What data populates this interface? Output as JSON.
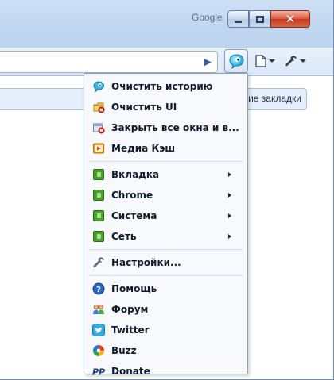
{
  "titlebar": {
    "brand": "Google",
    "buttons": [
      "minimize",
      "maximize",
      "close"
    ]
  },
  "toolbar": {
    "go_icon": "play-arrow-icon",
    "ext_icon": "extension-speech-bubble-icon",
    "page_icon": "page-icon",
    "wrench_icon": "wrench-icon"
  },
  "bookmarks": {
    "other_label": "Другие закладки",
    "visible_label": "ие закладки"
  },
  "menu": {
    "items": [
      {
        "label": "Очистить историю",
        "icon": "clean-history-icon",
        "submenu": false
      },
      {
        "label": "Очистить UI",
        "icon": "clean-ui-icon",
        "submenu": false
      },
      {
        "label": "Закрыть все окна и в...",
        "icon": "close-windows-icon",
        "submenu": false
      },
      {
        "label": "Медиа Кэш",
        "icon": "media-cache-icon",
        "submenu": false
      },
      {
        "label": "Вкладка",
        "icon": "puzzle-icon",
        "submenu": true
      },
      {
        "label": "Chrome",
        "icon": "puzzle-icon",
        "submenu": true
      },
      {
        "label": "Система",
        "icon": "puzzle-icon",
        "submenu": true
      },
      {
        "label": "Сеть",
        "icon": "puzzle-icon",
        "submenu": true
      },
      {
        "label": "Настройки...",
        "icon": "wrench-icon",
        "submenu": false
      },
      {
        "label": "Помощь",
        "icon": "help-icon",
        "submenu": false
      },
      {
        "label": "Форум",
        "icon": "forum-icon",
        "submenu": false
      },
      {
        "label": "Twitter",
        "icon": "twitter-icon",
        "submenu": false
      },
      {
        "label": "Buzz",
        "icon": "buzz-icon",
        "submenu": false
      },
      {
        "label": "Donate",
        "icon": "paypal-icon",
        "submenu": false
      }
    ]
  },
  "colors": {
    "titlebar": "#c3d8f1",
    "close_button": "#d44a2f",
    "menu_bg": "#f7f9fd",
    "puzzle_green": "#4aa02c"
  }
}
